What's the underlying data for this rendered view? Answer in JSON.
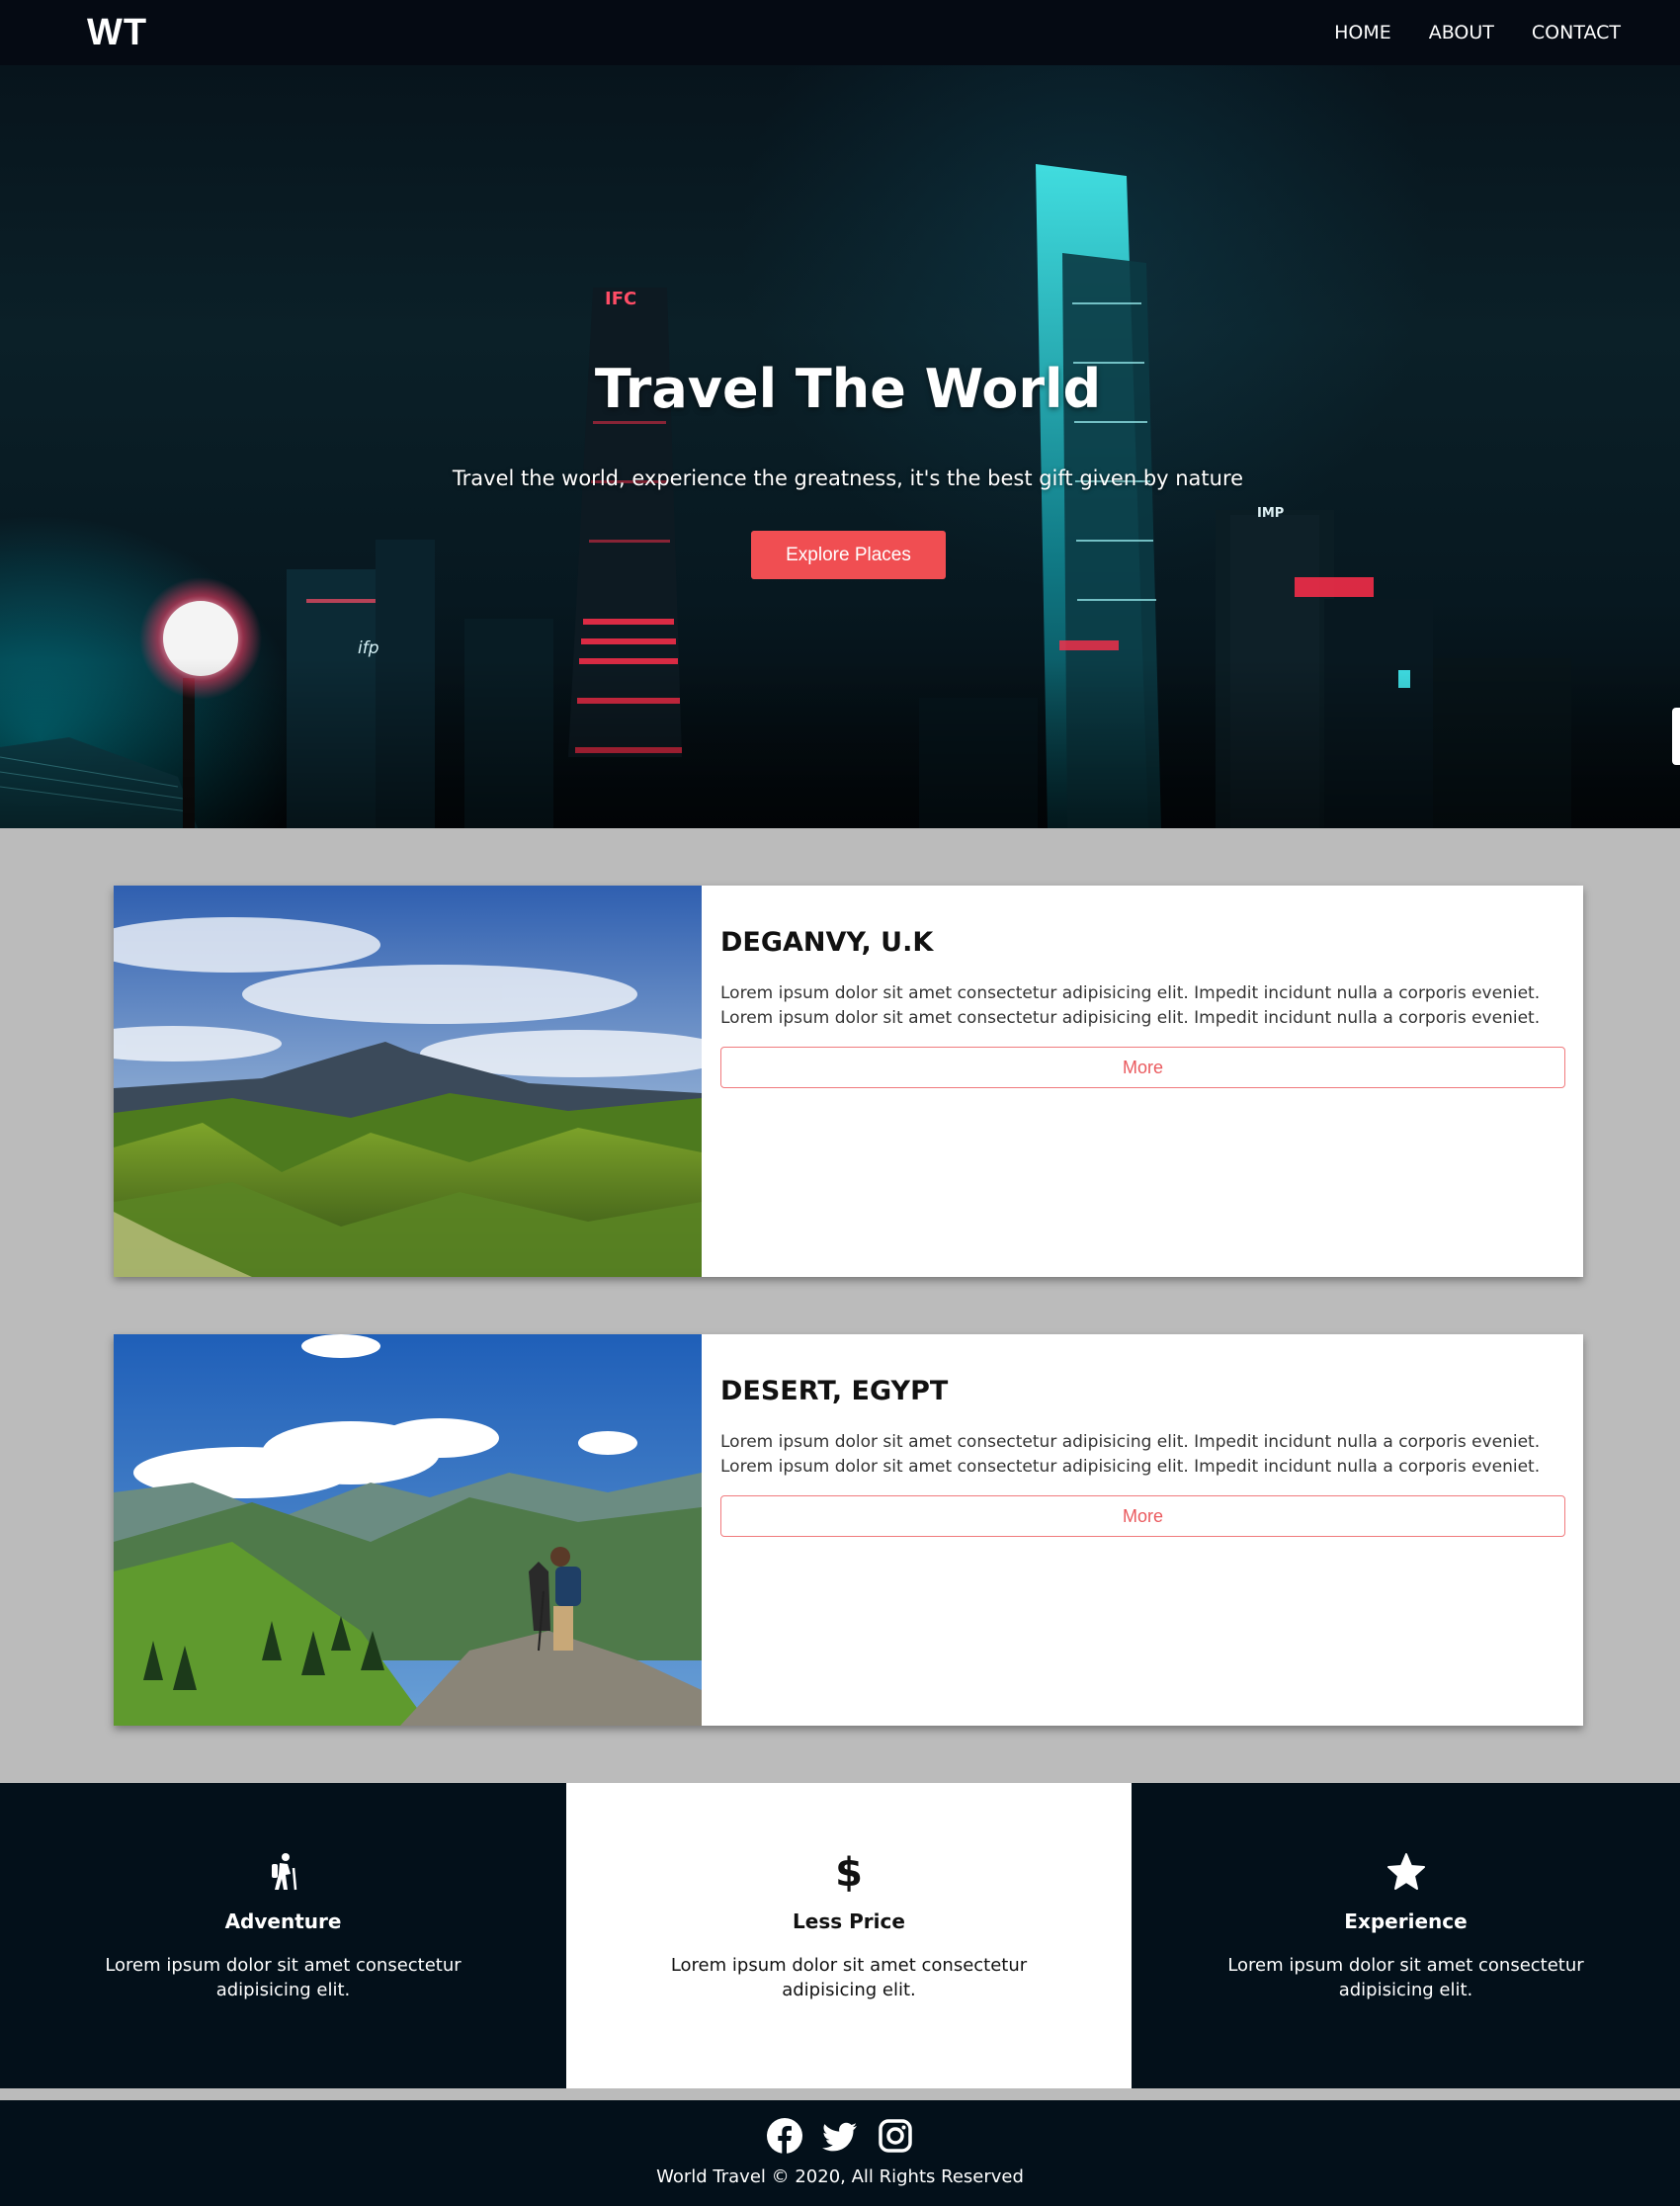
{
  "brand": {
    "logo": "WT"
  },
  "nav": {
    "links": [
      "HOME",
      "ABOUT",
      "CONTACT"
    ]
  },
  "hero": {
    "title": "Travel The World",
    "subtitle": "Travel the world, experience the greatness, it's the best gift given by nature",
    "button": "Explore Places",
    "building_signs": [
      "IFC",
      "ifp",
      "IMP"
    ]
  },
  "cards": [
    {
      "title": "DEGANVY, U.K",
      "text": "Lorem ipsum dolor sit amet consectetur adipisicing elit. Impedit incidunt nulla a corporis eveniet. Lorem ipsum dolor sit amet consectetur adipisicing elit. Impedit incidunt nulla a corporis eveniet.",
      "button": "More",
      "image": "mountain-landscape"
    },
    {
      "title": "DESERT, EGYPT",
      "text": "Lorem ipsum dolor sit amet consectetur adipisicing elit. Impedit incidunt nulla a corporis eveniet. Lorem ipsum dolor sit amet consectetur adipisicing elit. Impedit incidunt nulla a corporis eveniet.",
      "button": "More",
      "image": "hiker-mountains"
    }
  ],
  "features": [
    {
      "icon": "hiking-icon",
      "title": "Adventure",
      "text": "Lorem ipsum dolor sit amet consectetur adipisicing elit."
    },
    {
      "icon": "dollar-icon",
      "title": "Less Price",
      "text": "Lorem ipsum dolor sit amet consectetur adipisicing elit."
    },
    {
      "icon": "star-icon",
      "title": "Experience",
      "text": "Lorem ipsum dolor sit amet consectetur adipisicing elit."
    }
  ],
  "footer": {
    "social": [
      "facebook-icon",
      "twitter-icon",
      "instagram-icon"
    ],
    "copyright": "World Travel © 2020, All Rights Reserved"
  },
  "colors": {
    "nav_bg": "#050a13",
    "accent": "#f04e52",
    "dark_section": "#03101a",
    "page_bg": "#bbbbbb"
  }
}
